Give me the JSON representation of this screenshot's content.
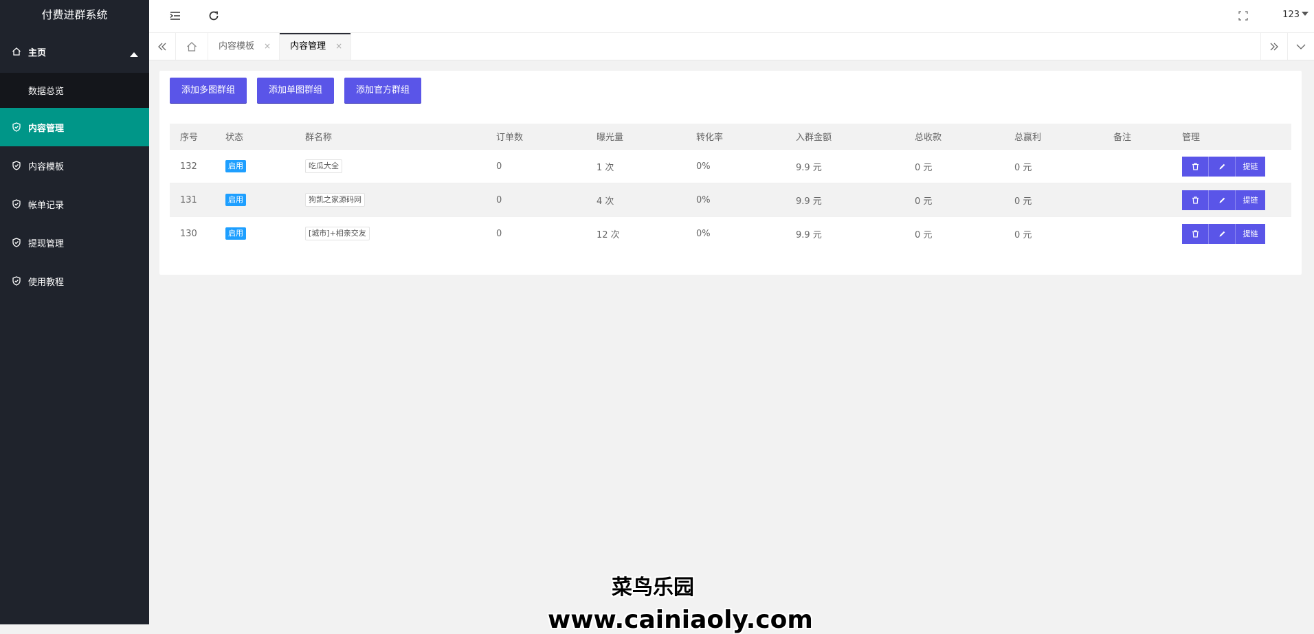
{
  "sidebar": {
    "title": "付费进群系统",
    "group": {
      "label": "主页",
      "icon": "home-icon"
    },
    "sub_items": [
      {
        "label": "数据总览"
      }
    ],
    "items": [
      {
        "label": "内容管理",
        "icon": "shield-icon",
        "active": true
      },
      {
        "label": "内容模板",
        "icon": "shield-icon"
      },
      {
        "label": "帐单记录",
        "icon": "shield-icon"
      },
      {
        "label": "提现管理",
        "icon": "shield-icon"
      },
      {
        "label": "使用教程",
        "icon": "shield-icon"
      }
    ]
  },
  "topbar": {
    "icons": [
      "collapse-menu-icon",
      "refresh-icon",
      "fullscreen-icon"
    ],
    "user": "123"
  },
  "tabs": {
    "items": [
      {
        "label": "内容模板",
        "close": "×"
      },
      {
        "label": "内容管理",
        "close": "×",
        "active": true
      }
    ]
  },
  "toolbar": {
    "buttons": [
      "添加多图群组",
      "添加单图群组",
      "添加官方群组"
    ]
  },
  "table": {
    "headers": [
      "序号",
      "状态",
      "群名称",
      "订单数",
      "曝光量",
      "转化率",
      "入群金额",
      "总收款",
      "总赢利",
      "备注",
      "管理"
    ],
    "rows": [
      {
        "id": "132",
        "status": "启用",
        "name": "吃瓜大全",
        "orders": "0",
        "views": "1 次",
        "rate": "0%",
        "price": "9.9 元",
        "revenue": "0 元",
        "profit": "0 元",
        "note": ""
      },
      {
        "id": "131",
        "status": "启用",
        "name": "狗凯之家源码网",
        "orders": "0",
        "views": "4 次",
        "rate": "0%",
        "price": "9.9 元",
        "revenue": "0 元",
        "profit": "0 元",
        "note": ""
      },
      {
        "id": "130",
        "status": "启用",
        "name": "[城市]+相亲交友",
        "orders": "0",
        "views": "12 次",
        "rate": "0%",
        "price": "9.9 元",
        "revenue": "0 元",
        "profit": "0 元",
        "note": ""
      }
    ],
    "op_link_label": "提链"
  },
  "watermark": {
    "line1": "菜鸟乐园",
    "line2": "www.cainiaoly.com"
  },
  "colors": {
    "sidebar_bg": "#1f232c",
    "active_nav": "#009688",
    "primary_button": "#5a55e8",
    "status_badge": "#1e9fff"
  }
}
